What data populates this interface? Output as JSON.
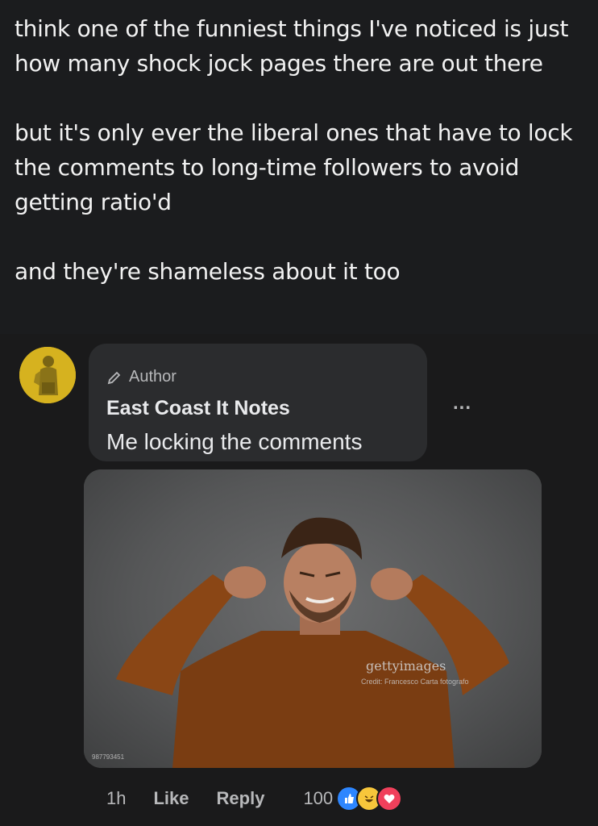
{
  "post": {
    "paragraphs": [
      "think one of the funniest things I've noticed is just how many shock jock pages there are out there",
      "but it's only ever the liberal ones that have to lock the comments to long-time followers to avoid getting ratio'd",
      "and they're shameless about it too"
    ]
  },
  "comment": {
    "badge_label": "Author",
    "page_name": "East Coast It Notes",
    "text": "Me locking the comments",
    "more_label": "...",
    "image": {
      "watermark": "gettyimages",
      "credit": "Credit: Francesco Carta fotografo",
      "image_id": "987793451"
    },
    "time": "1h",
    "like_label": "Like",
    "reply_label": "Reply",
    "reaction_count": "100",
    "reactions": [
      "like-icon",
      "haha-icon",
      "love-icon"
    ],
    "colors": {
      "like": "#2d86ff",
      "haha": "#f7c63b",
      "love": "#f0405b",
      "avatar": "#d6b21f"
    }
  }
}
